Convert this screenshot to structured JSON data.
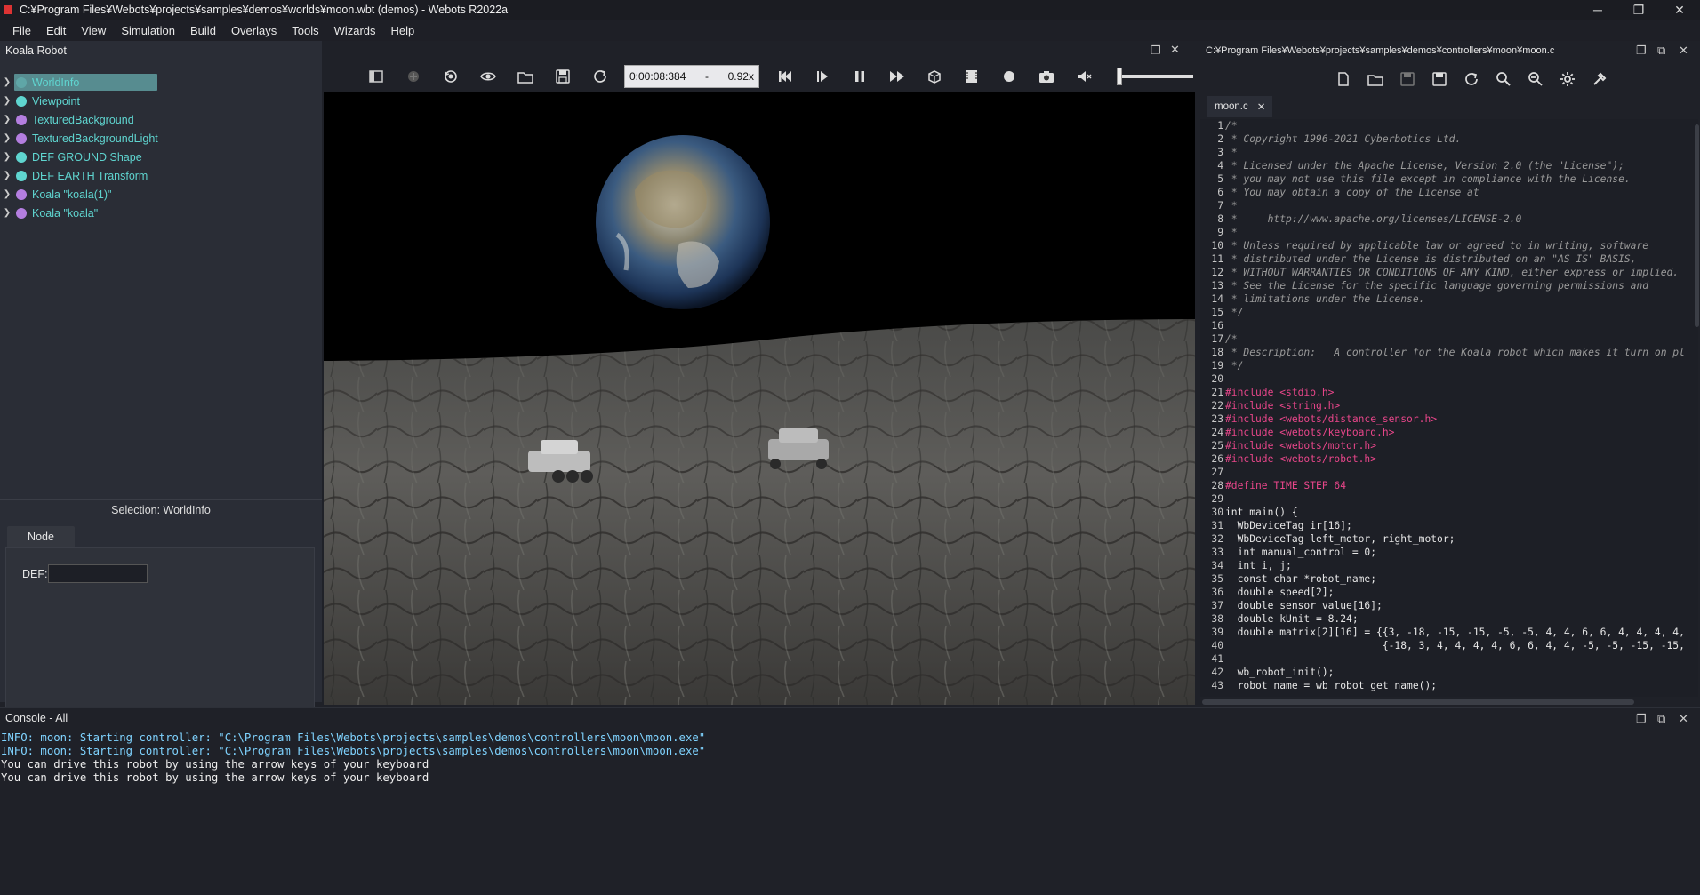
{
  "window": {
    "title": "C:¥Program Files¥Webots¥projects¥samples¥demos¥worlds¥moon.wbt (demos) - Webots R2022a",
    "minimize": "─",
    "maximize": "❐",
    "close": "✕"
  },
  "menu": [
    "File",
    "Edit",
    "View",
    "Simulation",
    "Build",
    "Overlays",
    "Tools",
    "Wizards",
    "Help"
  ],
  "left_panel": {
    "title": "Koala Robot",
    "tree": [
      {
        "label": "WorldInfo",
        "color": "#5fd5d0",
        "selected": true
      },
      {
        "label": "Viewpoint",
        "color": "#5fd5d0"
      },
      {
        "label": "TexturedBackground",
        "color": "#b47ee0"
      },
      {
        "label": "TexturedBackgroundLight",
        "color": "#b47ee0"
      },
      {
        "label": "DEF GROUND Shape",
        "color": "#5fd5d0"
      },
      {
        "label": "DEF EARTH Transform",
        "color": "#5fd5d0"
      },
      {
        "label": "Koala \"koala(1)\"",
        "color": "#b47ee0"
      },
      {
        "label": "Koala \"koala\"",
        "color": "#b47ee0"
      }
    ],
    "selection": "Selection: WorldInfo",
    "node_tab": "Node",
    "def_label": "DEF:",
    "def_value": ""
  },
  "toolbar": {
    "time": "0:00:08:384",
    "separator": "-",
    "speed": "0.92x",
    "volume": 0.0
  },
  "editor": {
    "path": "C:¥Program Files¥Webots¥projects¥samples¥demos¥controllers¥moon¥moon.c",
    "tab": "moon.c",
    "tab_close": "✕",
    "lines": [
      {
        "n": "1",
        "t": "/*",
        "k": "comment"
      },
      {
        "n": "2",
        "t": " * Copyright 1996-2021 Cyberbotics Ltd.",
        "k": "comment"
      },
      {
        "n": "3",
        "t": " *",
        "k": "comment"
      },
      {
        "n": "4",
        "t": " * Licensed under the Apache License, Version 2.0 (the \"License\");",
        "k": "comment"
      },
      {
        "n": "5",
        "t": " * you may not use this file except in compliance with the License.",
        "k": "comment"
      },
      {
        "n": "6",
        "t": " * You may obtain a copy of the License at",
        "k": "comment"
      },
      {
        "n": "7",
        "t": " *",
        "k": "comment"
      },
      {
        "n": "8",
        "t": " *     http://www.apache.org/licenses/LICENSE-2.0",
        "k": "comment"
      },
      {
        "n": "9",
        "t": " *",
        "k": "comment"
      },
      {
        "n": "10",
        "t": " * Unless required by applicable law or agreed to in writing, software",
        "k": "comment"
      },
      {
        "n": "11",
        "t": " * distributed under the License is distributed on an \"AS IS\" BASIS,",
        "k": "comment"
      },
      {
        "n": "12",
        "t": " * WITHOUT WARRANTIES OR CONDITIONS OF ANY KIND, either express or implied.",
        "k": "comment"
      },
      {
        "n": "13",
        "t": " * See the License for the specific language governing permissions and",
        "k": "comment"
      },
      {
        "n": "14",
        "t": " * limitations under the License.",
        "k": "comment"
      },
      {
        "n": "15",
        "t": " */",
        "k": "comment"
      },
      {
        "n": "16",
        "t": "",
        "k": "plain"
      },
      {
        "n": "17",
        "t": "/*",
        "k": "comment"
      },
      {
        "n": "18",
        "t": " * Description:   A controller for the Koala robot which makes it turn on pl",
        "k": "comment"
      },
      {
        "n": "19",
        "t": " */",
        "k": "comment"
      },
      {
        "n": "20",
        "t": "",
        "k": "plain"
      },
      {
        "n": "21",
        "t": "#include <stdio.h>",
        "k": "include"
      },
      {
        "n": "22",
        "t": "#include <string.h>",
        "k": "include"
      },
      {
        "n": "23",
        "t": "#include <webots/distance_sensor.h>",
        "k": "include"
      },
      {
        "n": "24",
        "t": "#include <webots/keyboard.h>",
        "k": "include"
      },
      {
        "n": "25",
        "t": "#include <webots/motor.h>",
        "k": "include"
      },
      {
        "n": "26",
        "t": "#include <webots/robot.h>",
        "k": "include"
      },
      {
        "n": "27",
        "t": "",
        "k": "plain"
      },
      {
        "n": "28",
        "t": "#define TIME_STEP 64",
        "k": "define"
      },
      {
        "n": "29",
        "t": "",
        "k": "plain"
      },
      {
        "n": "30",
        "t": "int main() {",
        "k": "plain"
      },
      {
        "n": "31",
        "t": "  WbDeviceTag ir[16];",
        "k": "plain"
      },
      {
        "n": "32",
        "t": "  WbDeviceTag left_motor, right_motor;",
        "k": "plain"
      },
      {
        "n": "33",
        "t": "  int manual_control = 0;",
        "k": "plain"
      },
      {
        "n": "34",
        "t": "  int i, j;",
        "k": "plain"
      },
      {
        "n": "35",
        "t": "  const char *robot_name;",
        "k": "plain"
      },
      {
        "n": "36",
        "t": "  double speed[2];",
        "k": "plain"
      },
      {
        "n": "37",
        "t": "  double sensor_value[16];",
        "k": "plain"
      },
      {
        "n": "38",
        "t": "  double kUnit = 8.24;",
        "k": "plain"
      },
      {
        "n": "39",
        "t": "  double matrix[2][16] = {{3, -18, -15, -15, -5, -5, 4, 4, 6, 6, 4, 4, 4, 4,",
        "k": "plain"
      },
      {
        "n": "40",
        "t": "                          {-18, 3, 4, 4, 4, 4, 6, 6, 4, 4, -5, -5, -15, -15,",
        "k": "plain"
      },
      {
        "n": "41",
        "t": "",
        "k": "plain"
      },
      {
        "n": "42",
        "t": "  wb_robot_init();",
        "k": "plain"
      },
      {
        "n": "43",
        "t": "  robot_name = wb_robot_get_name();",
        "k": "plain"
      }
    ]
  },
  "console": {
    "title": "Console - All",
    "lines": [
      {
        "t": "INFO: moon: Starting controller: \"C:\\Program Files\\Webots\\projects\\samples\\demos\\controllers\\moon\\moon.exe\"",
        "k": "info"
      },
      {
        "t": "INFO: moon: Starting controller: \"C:\\Program Files\\Webots\\projects\\samples\\demos\\controllers\\moon\\moon.exe\"",
        "k": "info"
      },
      {
        "t": "You can drive this robot by using the arrow keys of your keyboard",
        "k": "plain"
      },
      {
        "t": "You can drive this robot by using the arrow keys of your keyboard",
        "k": "plain"
      }
    ]
  },
  "panel_icons": {
    "undock": "❐",
    "float": "⧉",
    "close": "✕"
  }
}
